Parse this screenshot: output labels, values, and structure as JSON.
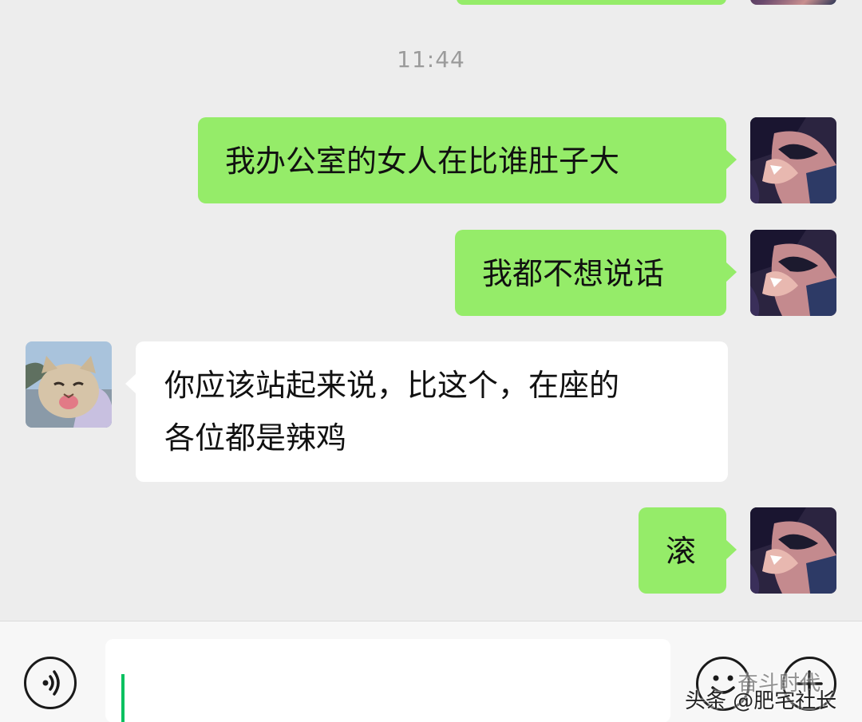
{
  "timestamp": "11:44",
  "messages": [
    {
      "sender": "me",
      "text": "我办公室的女人在比谁肚子大"
    },
    {
      "sender": "me",
      "text": "我都不想说话"
    },
    {
      "sender": "them",
      "text": "你应该站起来说，比这个，在座的\n各位都是辣鸡"
    },
    {
      "sender": "me",
      "text": "滚"
    }
  ],
  "input": {
    "value": "",
    "voice_icon": "voice-icon",
    "emoji_icon": "emoji-icon",
    "plus_icon": "plus-icon"
  },
  "watermark": {
    "text": "头条 @肥宅社长",
    "overlay": "奋斗时代"
  },
  "colors": {
    "my_bubble": "#95ec69",
    "their_bubble": "#ffffff",
    "background": "#ededed",
    "caret": "#07c160"
  }
}
